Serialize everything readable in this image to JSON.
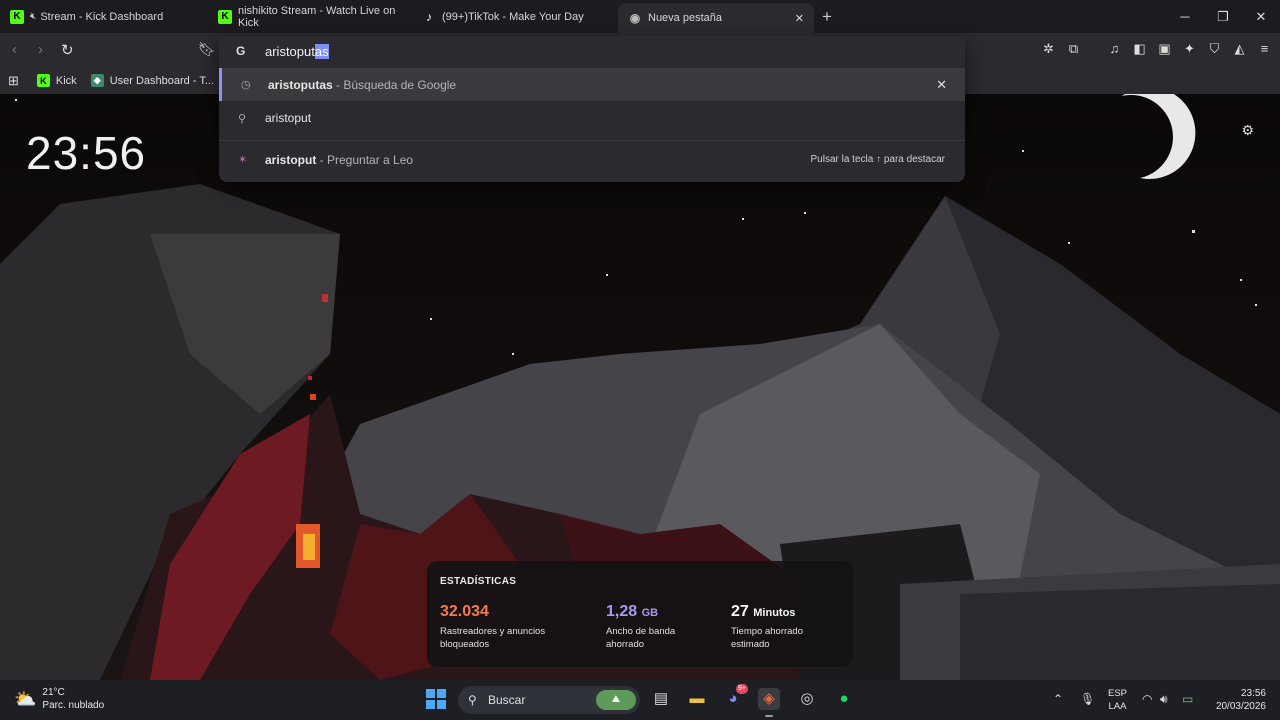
{
  "tabs": [
    {
      "title": "Stream - Kick Dashboard",
      "favicon": "kick-icon",
      "muted": true
    },
    {
      "title": "nishikito Stream - Watch Live on Kick",
      "favicon": "kick-icon"
    },
    {
      "title": "(99+)TikTok - Make Your Day",
      "favicon": "tiktok-icon"
    },
    {
      "title": "Nueva pestaña",
      "favicon": "brave-icon",
      "active": true
    }
  ],
  "bookmarks": [
    {
      "label": "Kick"
    },
    {
      "label": "User Dashboard - T..."
    }
  ],
  "omnibox": {
    "typed_prefix": "aristoput",
    "typed_selected": "as",
    "suggestions": [
      {
        "bold": "aristoputas",
        "rest": " - Búsqueda de Google",
        "icon": "history-icon"
      },
      {
        "bold": "",
        "rest": "aristoput",
        "icon": "search-icon"
      },
      {
        "bold": "aristoput",
        "rest": " - Preguntar a Leo",
        "icon": "leo-icon",
        "hint": "Pulsar la tecla ↑ para destacar"
      }
    ]
  },
  "newtab": {
    "clock": "23:56"
  },
  "stats": {
    "title": "ESTADÍSTICAS",
    "items": [
      {
        "value": "32.034",
        "unit": "",
        "desc_line1": "Rastreadores y anuncios",
        "desc_line2": "bloqueados",
        "color": "#f07a52"
      },
      {
        "value": "1,28",
        "unit": "GB",
        "desc_line1": "Ancho de banda",
        "desc_line2": "ahorrado",
        "color": "#a39cf2"
      },
      {
        "value": "27",
        "unit": "Minutos",
        "desc_line1": "Tiempo ahorrado",
        "desc_line2": "estimado",
        "color": "#f5f5f5"
      }
    ]
  },
  "taskbar": {
    "weather_temp": "21°C",
    "weather_desc": "Parc. nublado",
    "search_label": "Buscar",
    "discord_badge": "9+",
    "lang_line1": "ESP",
    "lang_line2": "LAA",
    "time": "23:56",
    "date": "20/03/2026"
  }
}
